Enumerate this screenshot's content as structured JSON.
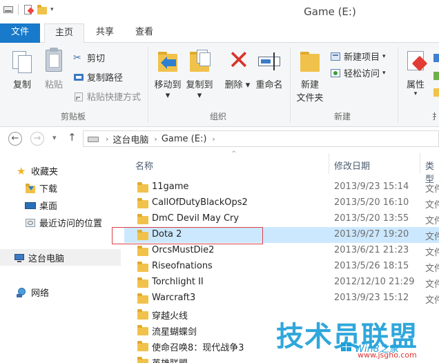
{
  "window": {
    "title": "Game (E:)"
  },
  "ribbon_tabs": [
    "文件",
    "主页",
    "共享",
    "查看"
  ],
  "ribbon": {
    "clipboard": {
      "label": "剪贴板",
      "copy": "复制",
      "paste": "粘贴",
      "cut": "剪切",
      "copy_path": "复制路径",
      "paste_shortcut": "粘贴快捷方式"
    },
    "organize": {
      "label": "组织",
      "move_to": "移动到",
      "copy_to": "复制到",
      "delete": "删除",
      "rename": "重命名"
    },
    "new": {
      "label": "新建",
      "new_folder_line1": "新建",
      "new_folder_line2": "文件夹",
      "new_item": "新建项目",
      "easy_access": "轻松访问"
    },
    "open": {
      "properties": "属性",
      "label_partial": "扌"
    }
  },
  "address": {
    "segments": [
      "这台电脑",
      "Game (E:)"
    ]
  },
  "nav_pane": {
    "favorites": "收藏夹",
    "downloads": "下载",
    "desktop": "桌面",
    "recent": "最近访问的位置",
    "this_pc": "这台电脑",
    "network": "网络"
  },
  "columns": {
    "name": "名称",
    "date": "修改日期",
    "type": "类型"
  },
  "files": [
    {
      "name": "11game",
      "date": "2013/9/23 15:14",
      "type": "文件"
    },
    {
      "name": "CallOfDutyBlackOps2",
      "date": "2013/5/20 16:10",
      "type": "文件"
    },
    {
      "name": "DmC Devil May Cry",
      "date": "2013/5/20 13:55",
      "type": "文件"
    },
    {
      "name": "Dota 2",
      "date": "2013/9/27 19:20",
      "type": "文件"
    },
    {
      "name": "OrcsMustDie2",
      "date": "2013/6/21 21:23",
      "type": "文件"
    },
    {
      "name": "Riseofnations",
      "date": "2013/5/26 18:15",
      "type": "文件"
    },
    {
      "name": "Torchlight II",
      "date": "2012/12/10 21:29",
      "type": "文件"
    },
    {
      "name": "Warcraft3",
      "date": "2013/9/23 15:12",
      "type": "文件"
    },
    {
      "name": "穿越火线",
      "date": "",
      "type": ""
    },
    {
      "name": "流星蝴蝶剑",
      "date": "",
      "type": ""
    },
    {
      "name": "使命召唤8：现代战争3",
      "date": "",
      "type": ""
    },
    {
      "name": "英雄联盟",
      "date": "",
      "type": ""
    }
  ],
  "selected_file": "Dota 2",
  "watermark": {
    "main": "技术员联盟",
    "sub": "Win8之家",
    "url": "www.jsgho.com"
  },
  "colors": {
    "file_tab": "#1979ca",
    "selection": "#cce8ff",
    "highlight_box": "#d94048",
    "folder": "#f1c24b",
    "watermark": "#1fa0d8"
  }
}
